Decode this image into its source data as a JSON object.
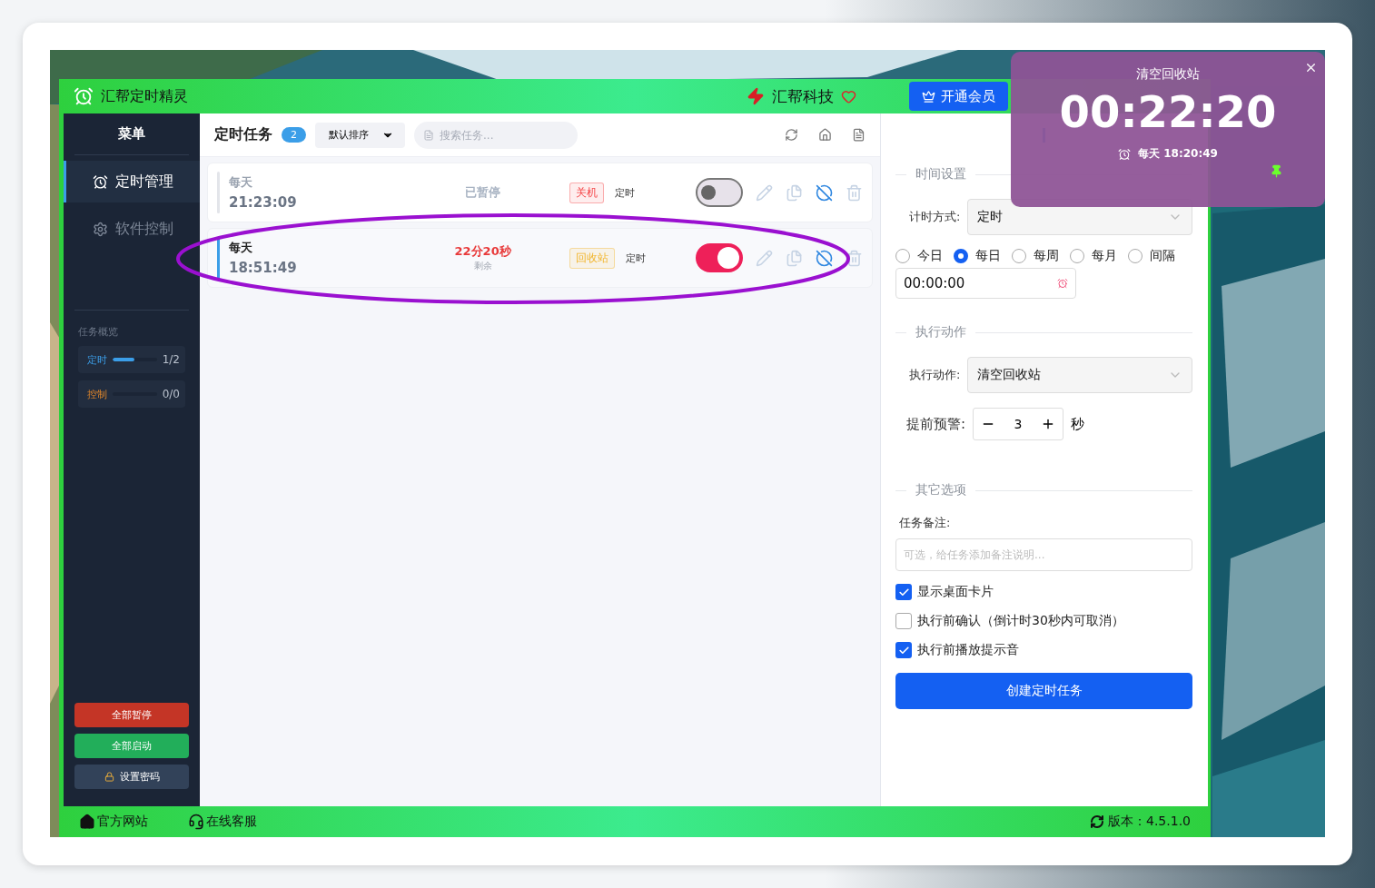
{
  "app": {
    "title": "汇帮定时精灵",
    "brand": "汇帮科技",
    "vip_button": "开通会员"
  },
  "sidebar": {
    "heading": "菜单",
    "items": [
      {
        "label": "定时管理",
        "selected": true,
        "kind": "clock"
      },
      {
        "label": "软件控制",
        "selected": false,
        "kind": "gear"
      }
    ],
    "overview_title": "任务概览",
    "overview": [
      {
        "label": "定时",
        "count": "1/2",
        "level": 0.5,
        "kind": "timer"
      },
      {
        "label": "控制",
        "count": "0/0",
        "kind": "control"
      }
    ],
    "buttons": [
      {
        "label": "全部暂停",
        "kind": "danger"
      },
      {
        "label": "全部启动",
        "kind": "success"
      },
      {
        "label": "设置密码",
        "kind": "lock"
      }
    ]
  },
  "tasks": {
    "title": "定时任务",
    "count": "2",
    "sort": "默认排序",
    "search_placeholder": "搜索任务...",
    "rows": [
      {
        "repeat": "每天",
        "time": "21:23:09",
        "status": "已暂停",
        "tag": {
          "label": "关机",
          "kind": "danger"
        },
        "mode": "定时",
        "on": false
      },
      {
        "repeat": "每天",
        "time": "18:51:49",
        "status": "22分20秒",
        "status_note": "剩余",
        "tag": {
          "label": "回收站",
          "kind": "warning"
        },
        "mode": "定时",
        "on": true
      }
    ]
  },
  "form": {
    "time_section": "时间设置",
    "mode_label": "计时方式:",
    "mode_value": "定时",
    "radios": [
      {
        "label": "今日",
        "selected": false
      },
      {
        "label": "每日",
        "selected": true
      },
      {
        "label": "每周",
        "selected": false
      },
      {
        "label": "每月",
        "selected": false
      },
      {
        "label": "间隔",
        "selected": false
      }
    ],
    "time_value": "00:00:00",
    "action_section": "执行动作",
    "action_label": "执行动作:",
    "action_value": "清空回收站",
    "warn_label": "提前预警:",
    "warn_value": "3",
    "warn_unit": "秒",
    "other_section": "其它选项",
    "note_label": "任务备注:",
    "note_placeholder": "可选，给任务添加备注说明...",
    "options": [
      {
        "label": "显示桌面卡片",
        "checked": true
      },
      {
        "label": "执行前确认（倒计时30秒内可取消）",
        "checked": false
      },
      {
        "label": "执行前播放提示音",
        "checked": true
      }
    ],
    "submit": "创建定时任务"
  },
  "footer": {
    "links": [
      {
        "label": "官方网站",
        "kind": "home"
      },
      {
        "label": "在线客服",
        "kind": "support"
      }
    ],
    "version": "版本：4.5.1.0"
  },
  "card": {
    "title": "清空回收站",
    "countdown": "00:22:20",
    "schedule": "每天 18:20:49"
  }
}
